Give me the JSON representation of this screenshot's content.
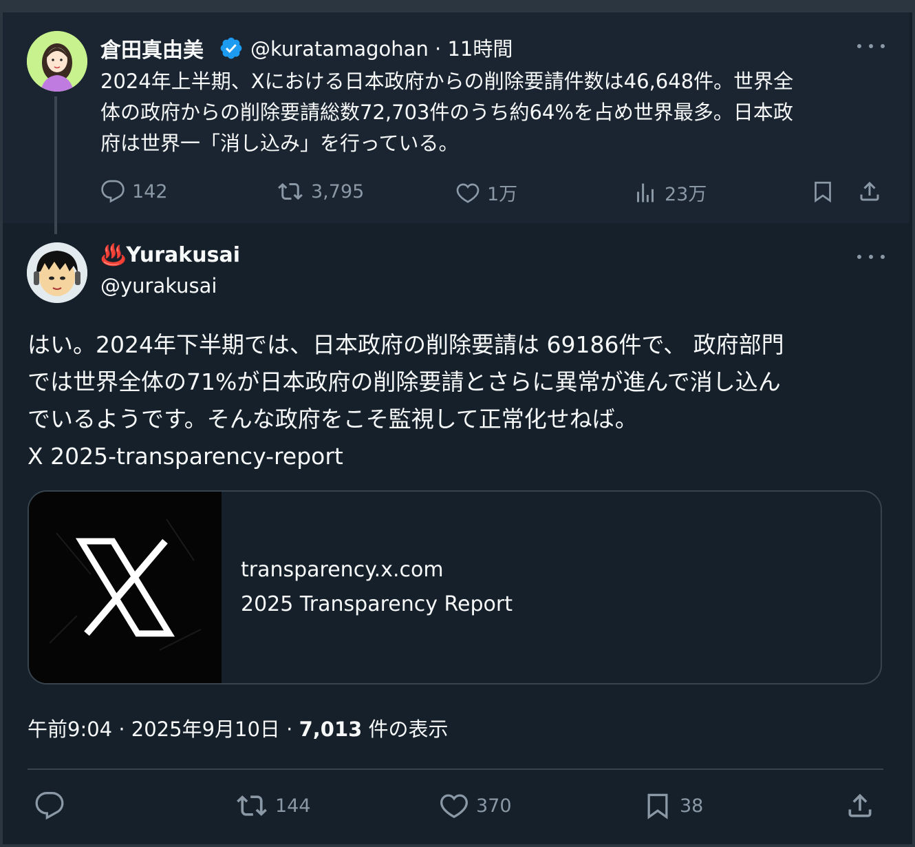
{
  "parent_tweet": {
    "author_name": "倉田真由美",
    "handle": "@kuratamagohan",
    "separator": "·",
    "time": "11時間",
    "text_lines": [
      "2024年上半期、Xにおける日本政府からの削除要請件数は46,648件。世界全",
      "体の政府からの削除要請総数72,703件のうち約64%を占め世界最多。日本政",
      "府は世界一「消し込み」を行っている。"
    ],
    "actions": {
      "replies": "142",
      "reposts": "3,795",
      "likes": "1万",
      "views": "23万"
    }
  },
  "main_tweet": {
    "author_emoji": "♨️",
    "author_name": "Yurakusai",
    "handle": "@yurakusai",
    "text_lines": [
      "はい。2024年下半期では、日本政府の削除要請は 69186件で、 政府部門",
      "では世界全体の71%が日本政府の削除要請とさらに異常が進んで消し込ん",
      "でいるようです。そんな政府をこそ監視して正常化せねば。",
      "X 2025-transparency-report"
    ],
    "card": {
      "domain": "transparency.x.com",
      "title": "2025 Transparency Report"
    },
    "meta": {
      "time": "午前9:04",
      "sep1": "·",
      "date": "2025年9月10日",
      "sep2": "·",
      "views_count": "7,013",
      "views_label": "件の表示"
    },
    "actions": {
      "reposts": "144",
      "likes": "370",
      "bookmarks": "38"
    }
  },
  "colors": {
    "background": "#15202b",
    "parent_background": "#1a2531",
    "text": "#f7f9f9",
    "muted": "#8b98a5",
    "verified": "#1d9bf0",
    "border": "#38444d"
  }
}
